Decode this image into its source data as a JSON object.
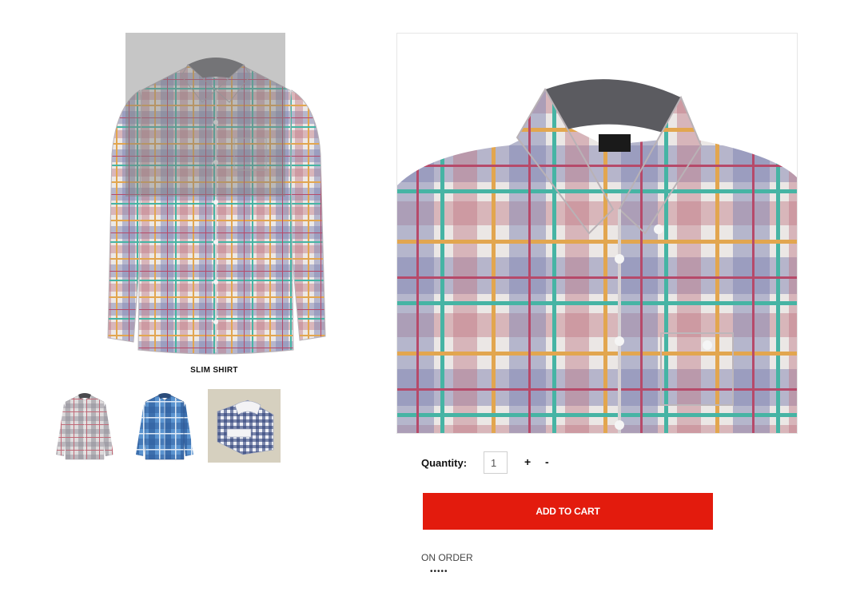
{
  "product": {
    "name": "SLIM SHIRT",
    "main_image": "plaid-shirt-photo",
    "zoom_image": "plaid-shirt-collar-zoom",
    "thumbnails": [
      {
        "name": "grey-plaid-shirt-thumbnail"
      },
      {
        "name": "blue-plaid-shirt-thumbnail"
      },
      {
        "name": "navy-gingham-folded-shirt-thumbnail"
      }
    ]
  },
  "quantity": {
    "label": "Quantity:",
    "value": "1",
    "plus": "+",
    "minus": "-"
  },
  "cart": {
    "button_label": "ADD TO CART"
  },
  "availability": {
    "status": "ON ORDER",
    "rating_dots": "•••••"
  },
  "colors": {
    "accent": "#e31b0d"
  }
}
